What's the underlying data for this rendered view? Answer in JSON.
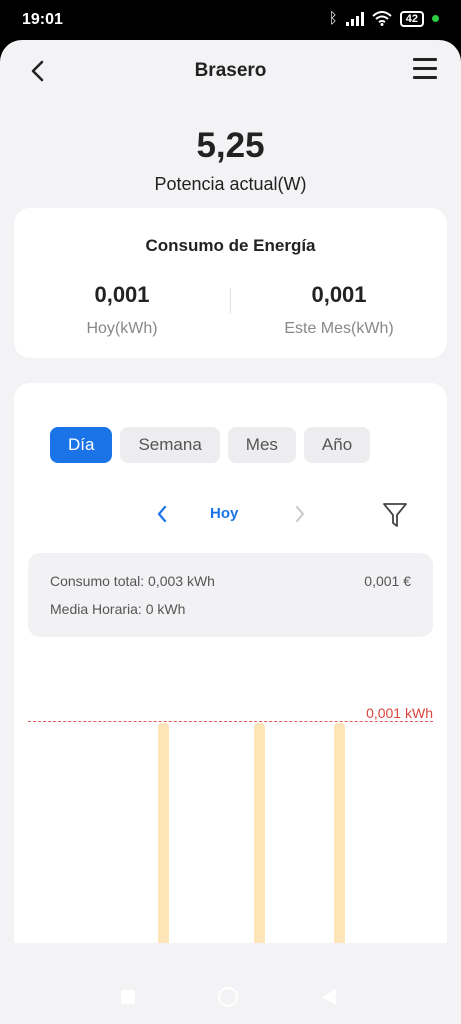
{
  "status": {
    "time": "19:01",
    "battery": "42",
    "icons": [
      "bluetooth-icon",
      "signal-icon",
      "wifi-icon",
      "battery-icon",
      "notification-dot-icon"
    ]
  },
  "header": {
    "title": "Brasero",
    "back_icon": "back-arrow-icon",
    "menu_icon": "hamburger-menu-icon"
  },
  "power": {
    "value": "5,25",
    "label": "Potencia actual(W)"
  },
  "energy": {
    "title": "Consumo de Energía",
    "today_value": "0,001",
    "today_label": "Hoy(kWh)",
    "month_value": "0,001",
    "month_label": "Este Mes(kWh)"
  },
  "tabs": [
    {
      "label": "Día",
      "active": true
    },
    {
      "label": "Semana",
      "active": false
    },
    {
      "label": "Mes",
      "active": false
    },
    {
      "label": "Año",
      "active": false
    }
  ],
  "date_nav": {
    "label": "Hoy",
    "prev_icon": "chevron-left-icon",
    "next_icon": "chevron-right-icon",
    "filter_icon": "filter-icon"
  },
  "summary": {
    "total": "Consumo total: 0,003 kWh",
    "cost": "0,001 €",
    "average": "Media Horaria: 0 kWh"
  },
  "chart_data": {
    "type": "bar",
    "max_label": "0,001 kWh",
    "bars": [
      {
        "value": 0.001
      },
      {
        "value": 0.001
      },
      {
        "value": 0.001
      }
    ],
    "colors": {
      "bar": "#fde5b8",
      "max_line": "#e05a5a",
      "avg_line": "#f0a030"
    }
  },
  "colors": {
    "accent": "#1b73e8",
    "background": "#f3f3f5",
    "card": "#ffffff"
  }
}
